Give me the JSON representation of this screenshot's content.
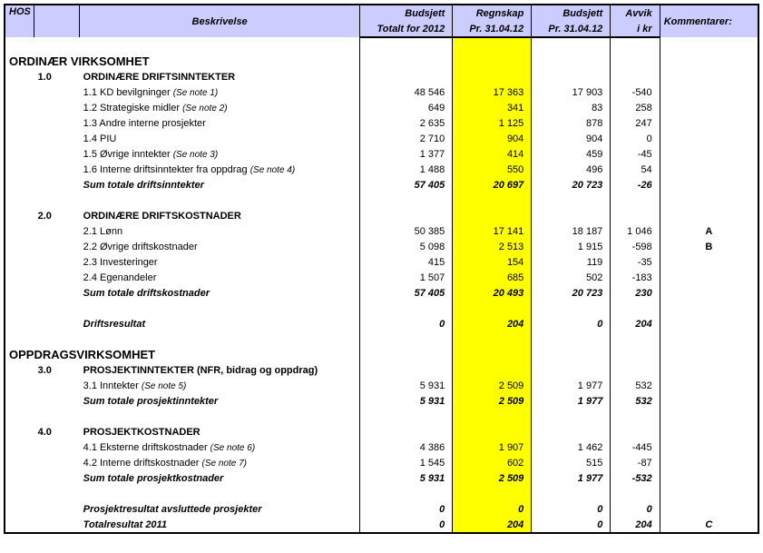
{
  "header": {
    "hos": "HOS",
    "desc": "Beskrivelse",
    "c1a": "Budsjett",
    "c1b": "Totalt for 2012",
    "c2a": "Regnskap",
    "c2b": "Pr. 31.04.12",
    "c3a": "Budsjett",
    "c3b": "Pr. 31.04.12",
    "c4a": "Avvik",
    "c4b": "i kr",
    "c5": "Kommentarer:"
  },
  "sections": [
    {
      "type": "blank"
    },
    {
      "type": "H1span",
      "label": "ORDINÆR VIRKSOMHET"
    },
    {
      "type": "H2",
      "code": "1.0",
      "label": "ORDINÆRE DRIFTSINNTEKTER"
    },
    {
      "type": "row",
      "num": "1.1",
      "label": "KD bevilgninger",
      "note": "(Se note 1)",
      "v": [
        "48 546",
        "17 363",
        "17 903",
        "-540",
        ""
      ]
    },
    {
      "type": "row",
      "num": "1.2",
      "label": "Strategiske midler",
      "note": "(Se note 2)",
      "v": [
        "649",
        "341",
        "83",
        "258",
        ""
      ]
    },
    {
      "type": "row",
      "num": "1.3",
      "label": "Andre interne prosjekter",
      "note": "",
      "v": [
        "2 635",
        "1 125",
        "878",
        "247",
        ""
      ]
    },
    {
      "type": "row",
      "num": "1.4",
      "label": "PIU",
      "note": "",
      "v": [
        "2 710",
        "904",
        "904",
        "0",
        ""
      ]
    },
    {
      "type": "row",
      "num": "1.5",
      "label": "Øvrige inntekter",
      "note": "(Se note 3)",
      "v": [
        "1 377",
        "414",
        "459",
        "-45",
        ""
      ]
    },
    {
      "type": "row",
      "num": "1.6",
      "label": "Interne driftsinntekter fra oppdrag",
      "note": "(Se note 4)",
      "v": [
        "1 488",
        "550",
        "496",
        "54",
        ""
      ]
    },
    {
      "type": "sum",
      "label": "Sum totale driftsinntekter",
      "v": [
        "57 405",
        "20 697",
        "20 723",
        "-26",
        ""
      ]
    },
    {
      "type": "blank"
    },
    {
      "type": "H2",
      "code": "2.0",
      "label": "ORDINÆRE DRIFTSKOSTNADER"
    },
    {
      "type": "row",
      "num": "2.1",
      "label": "Lønn",
      "note": "",
      "v": [
        "50 385",
        "17 141",
        "18 187",
        "1 046",
        "A"
      ]
    },
    {
      "type": "row",
      "num": "2.2",
      "label": "Øvrige driftskostnader",
      "note": "",
      "v": [
        "5 098",
        "2 513",
        "1 915",
        "-598",
        "B"
      ]
    },
    {
      "type": "row",
      "num": "2.3",
      "label": "Investeringer",
      "note": "",
      "v": [
        "415",
        "154",
        "119",
        "-35",
        ""
      ]
    },
    {
      "type": "row",
      "num": "2.4",
      "label": "Egenandeler",
      "note": "",
      "v": [
        "1 507",
        "685",
        "502",
        "-183",
        ""
      ]
    },
    {
      "type": "sum",
      "label": "Sum totale driftskostnader",
      "v": [
        "57 405",
        "20 493",
        "20 723",
        "230",
        ""
      ]
    },
    {
      "type": "blank"
    },
    {
      "type": "sum",
      "label": "Driftsresultat",
      "v": [
        "0",
        "204",
        "0",
        "204",
        ""
      ]
    },
    {
      "type": "blank"
    },
    {
      "type": "H1span",
      "label": "OPPDRAGSVIRKSOMHET"
    },
    {
      "type": "H2",
      "code": "3.0",
      "label": "PROSJEKTINNTEKTER (NFR, bidrag og oppdrag)"
    },
    {
      "type": "row",
      "num": "3.1",
      "label": "Inntekter",
      "note": "(Se note 5)",
      "v": [
        "5 931",
        "2 509",
        "1 977",
        "532",
        ""
      ]
    },
    {
      "type": "sum",
      "label": "Sum totale prosjektinntekter",
      "v": [
        "5 931",
        "2 509",
        "1 977",
        "532",
        ""
      ]
    },
    {
      "type": "blank"
    },
    {
      "type": "H2",
      "code": "4.0",
      "label": "PROSJEKTKOSTNADER"
    },
    {
      "type": "row",
      "num": "4.1",
      "label": "Eksterne driftskostnader",
      "note": "(Se note 6)",
      "v": [
        "4 386",
        "1 907",
        "1 462",
        "-445",
        ""
      ]
    },
    {
      "type": "row",
      "num": "4.2",
      "label": "Interne driftskostnader",
      "note": "(Se note 7)",
      "v": [
        "1 545",
        "602",
        "515",
        "-87",
        ""
      ]
    },
    {
      "type": "sum",
      "label": "Sum totale prosjektkostnader",
      "v": [
        "5 931",
        "2 509",
        "1 977",
        "-532",
        ""
      ]
    },
    {
      "type": "blank"
    },
    {
      "type": "sum",
      "label": "Prosjektresultat avsluttede prosjekter",
      "v": [
        "0",
        "0",
        "0",
        "0",
        ""
      ]
    },
    {
      "type": "sum",
      "label": "Totalresultat 2011",
      "v": [
        "0",
        "204",
        "0",
        "204",
        "C"
      ],
      "bottom": true
    }
  ]
}
